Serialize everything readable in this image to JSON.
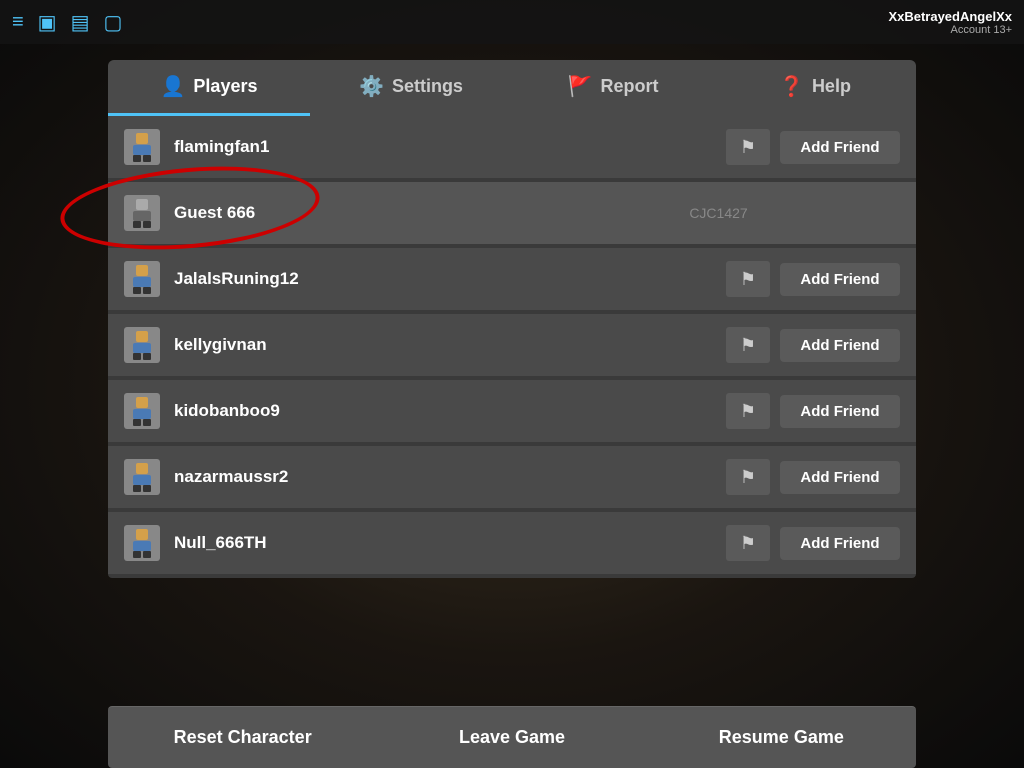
{
  "topbar": {
    "account_name": "XxBetrayedAngelXx",
    "account_sub": "Account 13+"
  },
  "tabs": [
    {
      "id": "players",
      "label": "Players",
      "icon": "👤",
      "active": true
    },
    {
      "id": "settings",
      "label": "Settings",
      "icon": "⚙️",
      "active": false
    },
    {
      "id": "report",
      "label": "Report",
      "icon": "🚩",
      "active": false
    },
    {
      "id": "help",
      "label": "Help",
      "icon": "❓",
      "active": false
    }
  ],
  "players": [
    {
      "name": "flamingfan1",
      "show_add": true,
      "add_label": "Add Friend",
      "selected": false
    },
    {
      "name": "Guest 666",
      "show_add": false,
      "add_label": "",
      "selected": true,
      "watermark": "CJC1427"
    },
    {
      "name": "JalalsRuning12",
      "show_add": true,
      "add_label": "Add Friend",
      "selected": false
    },
    {
      "name": "kellygivnan",
      "show_add": true,
      "add_label": "Add Friend",
      "selected": false
    },
    {
      "name": "kidobanboo9",
      "show_add": true,
      "add_label": "Add Friend",
      "selected": false
    },
    {
      "name": "nazarmaussr2",
      "show_add": true,
      "add_label": "Add Friend",
      "selected": false
    },
    {
      "name": "Null_666TH",
      "show_add": true,
      "add_label": "Add Friend",
      "selected": false
    }
  ],
  "bottom_buttons": {
    "reset": "Reset Character",
    "leave": "Leave Game",
    "resume": "Resume Game"
  },
  "icons": {
    "hamburger": "≡",
    "chat": "💬",
    "chat2": "💭",
    "backpack": "🎒",
    "flag": "⚑"
  }
}
